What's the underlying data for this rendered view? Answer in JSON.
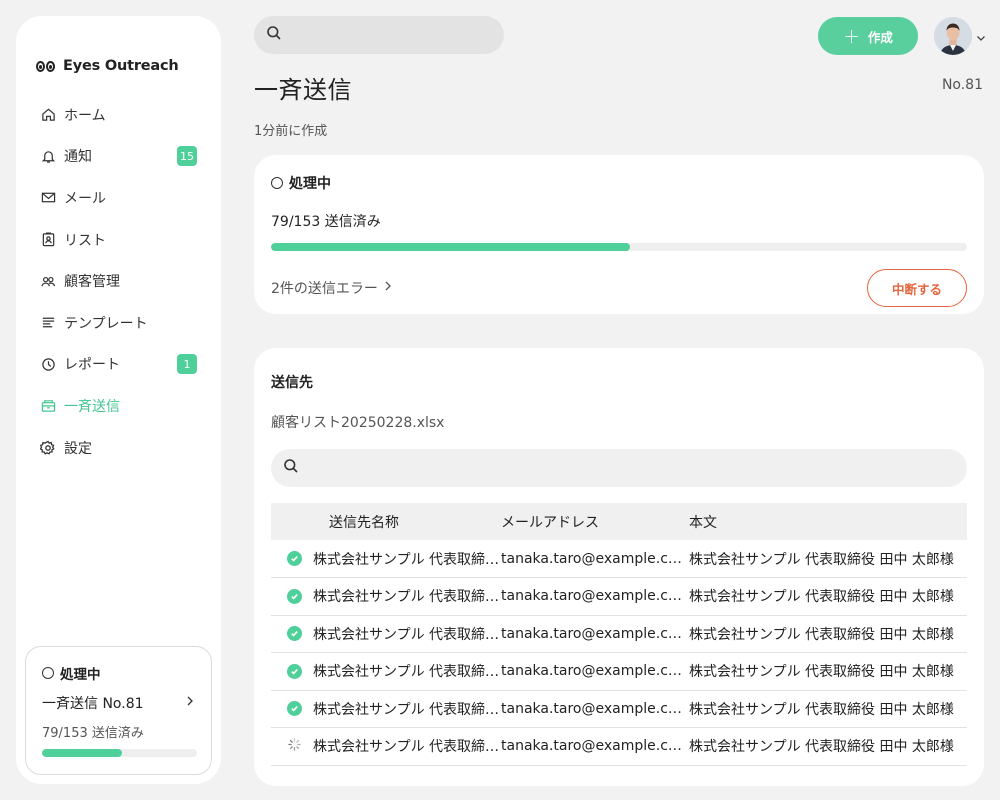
{
  "app": {
    "name": "Eyes Outreach"
  },
  "sidebar": {
    "items": [
      {
        "label": "ホーム",
        "icon": "home-icon"
      },
      {
        "label": "通知",
        "icon": "bell-icon",
        "badge": "15"
      },
      {
        "label": "メール",
        "icon": "mail-icon"
      },
      {
        "label": "リスト",
        "icon": "contact-list-icon"
      },
      {
        "label": "顧客管理",
        "icon": "users-icon"
      },
      {
        "label": "テンプレート",
        "icon": "template-icon"
      },
      {
        "label": "レポート",
        "icon": "clock-report-icon",
        "badge": "1"
      },
      {
        "label": "一斉送信",
        "icon": "broadcast-icon",
        "active": true
      },
      {
        "label": "設定",
        "icon": "gear-icon"
      }
    ],
    "status_card": {
      "status": "処理中",
      "title": "一斉送信 No.81",
      "count": "79/153 送信済み",
      "progress": 0.516
    }
  },
  "header": {
    "search_placeholder": "",
    "create_label": "作成"
  },
  "page": {
    "title": "一斉送信",
    "number": "No.81",
    "created": "1分前に作成"
  },
  "progress_card": {
    "status": "処理中",
    "count": "79/153 送信済み",
    "progress": 0.516,
    "errors_link": "2件の送信エラー",
    "stop_label": "中断する"
  },
  "recipients": {
    "title": "送信先",
    "file": "顧客リスト20250228.xlsx",
    "search_placeholder": "",
    "columns": [
      "送信先名称",
      "メールアドレス",
      "本文"
    ],
    "rows": [
      {
        "status": "sent",
        "name": "株式会社サンプル 代表取締役 田中 太郎",
        "email": "tanaka.taro@example.com",
        "body": "株式会社サンプル 代表取締役 田中 太郎様"
      },
      {
        "status": "sent",
        "name": "株式会社サンプル 代表取締役 田中 太郎",
        "email": "tanaka.taro@example.com",
        "body": "株式会社サンプル 代表取締役 田中 太郎様"
      },
      {
        "status": "sent",
        "name": "株式会社サンプル 代表取締役 田中 太郎",
        "email": "tanaka.taro@example.com",
        "body": "株式会社サンプル 代表取締役 田中 太郎様"
      },
      {
        "status": "sent",
        "name": "株式会社サンプル 代表取締役 田中 太郎",
        "email": "tanaka.taro@example.com",
        "body": "株式会社サンプル 代表取締役 田中 太郎様"
      },
      {
        "status": "sent",
        "name": "株式会社サンプル 代表取締役 田中 太郎",
        "email": "tanaka.taro@example.com",
        "body": "株式会社サンプル 代表取締役 田中 太郎様"
      },
      {
        "status": "sending",
        "name": "株式会社サンプル 代表取締役 田中 太郎",
        "email": "tanaka.taro@example.com",
        "body": "株式会社サンプル 代表取締役 田中 太郎様"
      }
    ]
  },
  "colors": {
    "accent": "#4fcf9a",
    "danger": "#e4663f",
    "background": "#f2f2f2"
  }
}
